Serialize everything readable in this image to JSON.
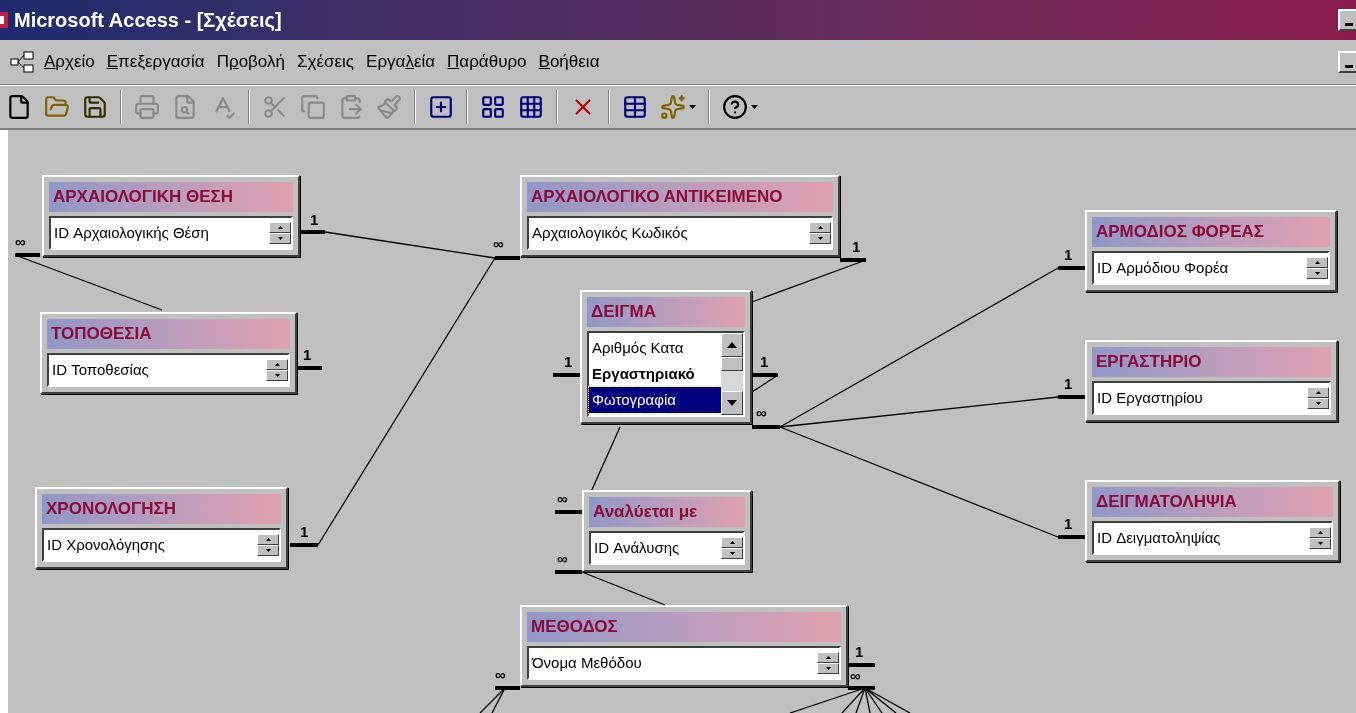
{
  "window": {
    "title": "Microsoft Access - [Σχέσεις]"
  },
  "menu": [
    {
      "key": "Α",
      "post": "ρχείο"
    },
    {
      "key": "Ε",
      "post": "πεξεργασία"
    },
    {
      "pre": "Π",
      "key": "ρ",
      "post": "οβολή"
    },
    {
      "pre": "Σ",
      "key": "χ",
      "post": "έσεις"
    },
    {
      "pre": "Εργα",
      "key": "λ",
      "post": "εία"
    },
    {
      "key": "Π",
      "post": "αράθυρο"
    },
    {
      "key": "Β",
      "post": "οήθεια"
    }
  ],
  "toolbar": [
    {
      "kind": "new",
      "disabled": false
    },
    {
      "kind": "open",
      "disabled": false
    },
    {
      "kind": "save",
      "disabled": false
    },
    {
      "kind": "sep"
    },
    {
      "kind": "print",
      "disabled": true
    },
    {
      "kind": "preview",
      "disabled": true
    },
    {
      "kind": "spelling",
      "disabled": true
    },
    {
      "kind": "sep"
    },
    {
      "kind": "cut",
      "disabled": true
    },
    {
      "kind": "copy",
      "disabled": true
    },
    {
      "kind": "paste",
      "disabled": true
    },
    {
      "kind": "painter",
      "disabled": true
    },
    {
      "kind": "sep"
    },
    {
      "kind": "show-table",
      "disabled": false
    },
    {
      "kind": "sep"
    },
    {
      "kind": "direct",
      "disabled": false
    },
    {
      "kind": "all",
      "disabled": false
    },
    {
      "kind": "sep"
    },
    {
      "kind": "delete",
      "disabled": false
    },
    {
      "kind": "sep"
    },
    {
      "kind": "database",
      "disabled": false
    },
    {
      "kind": "new-object",
      "disabled": false
    },
    {
      "kind": "sep"
    },
    {
      "kind": "help",
      "disabled": false
    }
  ],
  "tables": [
    {
      "title": "ΑΡΧΑΙΟΛΟΓΙΚΗ ΘΕΣΗ",
      "fields": [
        {
          "name": "ID Αρχαιολογικής Θέση",
          "bold": false,
          "selected": false
        }
      ]
    },
    {
      "title": "ΤΟΠΟΘΕΣΙΑ",
      "fields": [
        {
          "name": "ID Τοποθεσίας",
          "bold": false,
          "selected": false
        }
      ]
    },
    {
      "title": "ΧΡΟΝΟΛΟΓΗΣΗ",
      "fields": [
        {
          "name": "ID Χρονολόγησης",
          "bold": false,
          "selected": false
        }
      ]
    },
    {
      "title": "ΑΡΧΑΙΟΛΟΓΙΚΟ ΑΝΤΙΚΕΙΜΕΝΟ",
      "fields": [
        {
          "name": "Αρχαιολογικός Κωδικός",
          "bold": false,
          "selected": false
        }
      ]
    },
    {
      "title": "ΔΕΙΓΜΑ",
      "fields": [
        {
          "name": "Αριθμός Κατα",
          "bold": false,
          "selected": false
        },
        {
          "name": "Εργαστηριακό",
          "bold": true,
          "selected": false
        },
        {
          "name": "Φωτογραφία",
          "bold": false,
          "selected": true
        }
      ]
    },
    {
      "title": "ΑΡΜΟΔΙΟΣ ΦΟΡΕΑΣ",
      "fields": [
        {
          "name": "ID Αρμόδιου Φορέα",
          "bold": false,
          "selected": false
        }
      ]
    },
    {
      "title": "ΕΡΓΑΣΤΗΡΙΟ",
      "fields": [
        {
          "name": "ID Εργαστηρίου",
          "bold": false,
          "selected": false
        }
      ]
    },
    {
      "title": "ΔΕΙΓΜΑΤΟΛΗΨΙΑ",
      "fields": [
        {
          "name": "ID Δειγματοληψίας",
          "bold": false,
          "selected": false
        }
      ]
    },
    {
      "title": "Αναλύεται με",
      "fields": [
        {
          "name": "ID Ανάλυσης",
          "bold": false,
          "selected": false
        }
      ]
    },
    {
      "title": "ΜΕΘΟΔΟΣ",
      "fields": [
        {
          "name": "Όνομα Μεθόδου",
          "bold": false,
          "selected": false
        }
      ]
    }
  ],
  "relationships": [
    {
      "labels": [
        "∞"
      ]
    },
    {
      "labels": [
        "1",
        "∞"
      ]
    },
    {
      "labels": [
        "1"
      ]
    },
    {
      "labels": [
        "1"
      ]
    },
    {
      "labels": [
        "1"
      ]
    },
    {
      "labels": [
        "1"
      ]
    },
    {
      "labels": [
        "1"
      ]
    },
    {
      "labels": [
        "∞",
        "1"
      ]
    },
    {
      "labels": [
        "1"
      ]
    },
    {
      "labels": [
        "1"
      ]
    },
    {
      "labels": [
        "∞"
      ]
    },
    {
      "labels": [
        "∞"
      ]
    },
    {
      "labels": [
        "∞"
      ]
    },
    {
      "labels": [
        "1",
        "∞"
      ]
    }
  ]
}
